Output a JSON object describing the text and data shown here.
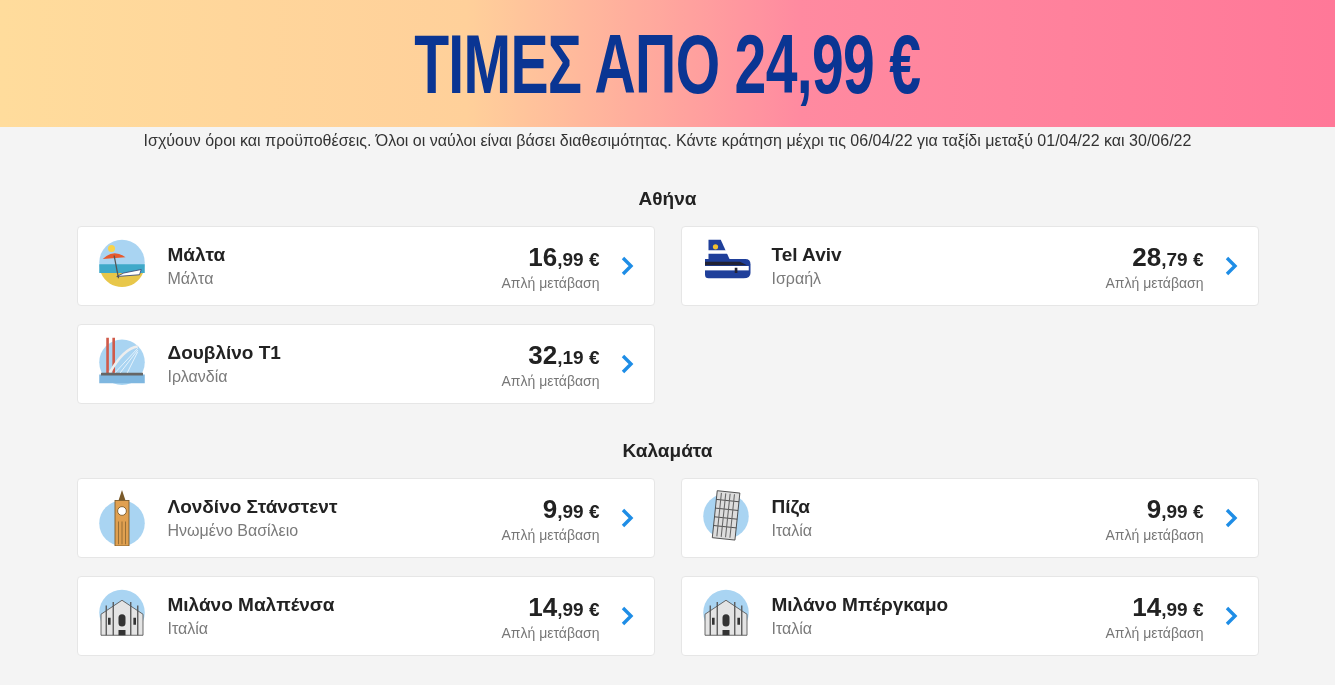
{
  "banner": {
    "headline": "ΤΙΜΕΣ ΑΠΟ 24,99 €"
  },
  "terms": "Ισχύουν όροι και προϋποθέσεις. Όλοι οι ναύλοι είναι βάσει διαθεσιμότητας. Κάντε κράτηση μέχρι τις 06/04/22 για ταξίδι μεταξύ 01/04/22 και 30/06/22",
  "sections": [
    {
      "origin": "Αθήνα",
      "destinations": [
        {
          "kind": "beach",
          "city": "Μάλτα",
          "country": "Μάλτα",
          "price_whole": "16",
          "price_rest": ",99 €",
          "fare_type": "Απλή μετάβαση"
        },
        {
          "kind": "plane",
          "city": "Tel Aviv",
          "country": "Ισραήλ",
          "price_whole": "28",
          "price_rest": ",79 €",
          "fare_type": "Απλή μετάβαση"
        },
        {
          "kind": "bridge",
          "city": "Δουβλίνο T1",
          "country": "Ιρλανδία",
          "price_whole": "32",
          "price_rest": ",19 €",
          "fare_type": "Απλή μετάβαση"
        }
      ]
    },
    {
      "origin": "Καλαμάτα",
      "destinations": [
        {
          "kind": "clocktower",
          "city": "Λονδίνο Στάνστεντ",
          "country": "Ηνωμένο Βασίλειο",
          "price_whole": "9",
          "price_rest": ",99 €",
          "fare_type": "Απλή μετάβαση"
        },
        {
          "kind": "leaningtower",
          "city": "Πίζα",
          "country": "Ιταλία",
          "price_whole": "9",
          "price_rest": ",99 €",
          "fare_type": "Απλή μετάβαση"
        },
        {
          "kind": "cathedral",
          "city": "Μιλάνο Μαλπένσα",
          "country": "Ιταλία",
          "price_whole": "14",
          "price_rest": ",99 €",
          "fare_type": "Απλή μετάβαση"
        },
        {
          "kind": "cathedral",
          "city": "Μιλάνο Μπέργκαμο",
          "country": "Ιταλία",
          "price_whole": "14",
          "price_rest": ",99 €",
          "fare_type": "Απλή μετάβαση"
        }
      ]
    }
  ]
}
